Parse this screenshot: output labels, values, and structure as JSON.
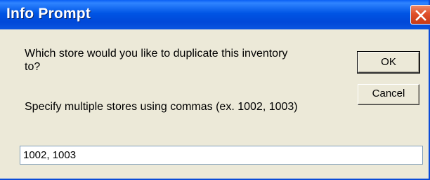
{
  "window": {
    "title": "Info Prompt"
  },
  "titlebar": {
    "close_icon": "close-x-icon"
  },
  "message": {
    "question": "Which store would you like to duplicate this inventory to?",
    "hint": "Specify multiple stores using commas (ex. 1002, 1003)"
  },
  "buttons": {
    "ok_label": "OK",
    "cancel_label": "Cancel"
  },
  "input": {
    "value": "1002, 1003"
  },
  "colors": {
    "titlebar": "#0055e5",
    "close_button": "#e0502a",
    "dialog_background": "#ece9d8",
    "input_border": "#7f9db9"
  }
}
